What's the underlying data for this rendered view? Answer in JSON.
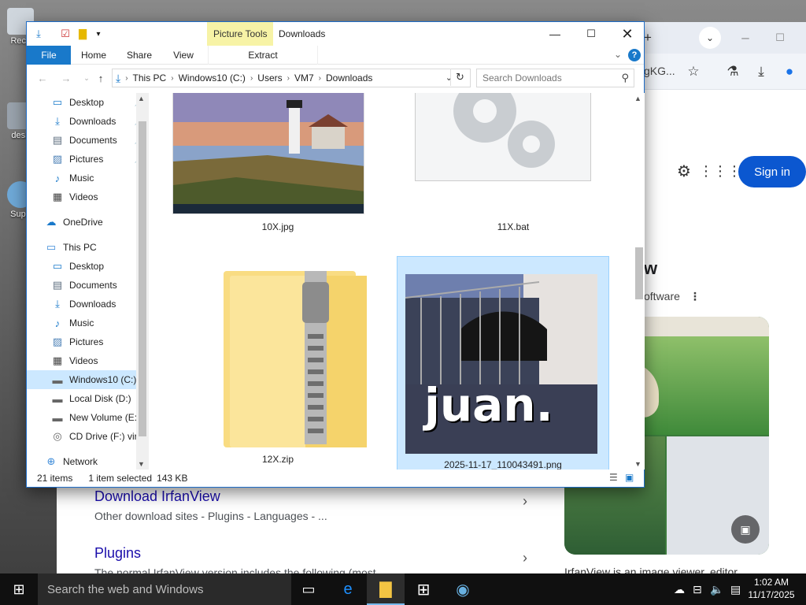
{
  "desktop": {
    "icons": [
      {
        "label": "Recy"
      },
      {
        "label": "desk"
      },
      {
        "label": "Supe"
      }
    ]
  },
  "browser": {
    "omnibox_fragment": "gKG...",
    "sign_in": "Sign in",
    "heading_fragment": "w",
    "subheading_fragment": "oftware",
    "more_menu": "⋮",
    "results": [
      {
        "title": "Download IrfanView",
        "desc": "Other download sites - Plugins - Languages - ..."
      },
      {
        "title": "Plugins",
        "desc": "The normal IrfanView version includes the following (most"
      }
    ],
    "panel_text": "IrfanView is an image viewer, editor,"
  },
  "explorer": {
    "context_tab": "Picture Tools",
    "title": "Downloads",
    "ribbon_tabs": [
      "File",
      "Home",
      "Share",
      "View"
    ],
    "ribbon_context": "Extract",
    "breadcrumbs": [
      "This PC",
      "Windows10 (C:)",
      "Users",
      "VM7",
      "Downloads"
    ],
    "search_placeholder": "Search Downloads",
    "nav": [
      {
        "label": "Desktop",
        "icon": "desktop-icon",
        "pinned": true
      },
      {
        "label": "Downloads",
        "icon": "download-icon",
        "pinned": true
      },
      {
        "label": "Documents",
        "icon": "document-icon",
        "pinned": true
      },
      {
        "label": "Pictures",
        "icon": "picture-icon",
        "pinned": true
      },
      {
        "label": "Music",
        "icon": "music-icon",
        "pinned": false
      },
      {
        "label": "Videos",
        "icon": "video-icon",
        "pinned": false
      },
      {
        "label": "OneDrive",
        "icon": "cloud-icon",
        "pinned": false
      },
      {
        "label": "This PC",
        "icon": "computer-icon",
        "pinned": false
      },
      {
        "label": "Desktop",
        "icon": "desktop-icon",
        "pinned": false
      },
      {
        "label": "Documents",
        "icon": "document-icon",
        "pinned": false
      },
      {
        "label": "Downloads",
        "icon": "download-icon",
        "pinned": false
      },
      {
        "label": "Music",
        "icon": "music-icon",
        "pinned": false
      },
      {
        "label": "Pictures",
        "icon": "picture-icon",
        "pinned": false
      },
      {
        "label": "Videos",
        "icon": "video-icon",
        "pinned": false
      },
      {
        "label": "Windows10 (C:)",
        "icon": "drive-icon",
        "pinned": false
      },
      {
        "label": "Local Disk (D:)",
        "icon": "drive-icon",
        "pinned": false
      },
      {
        "label": "New Volume (E:)",
        "icon": "drive-icon",
        "pinned": false
      },
      {
        "label": "CD Drive (F:) virt",
        "icon": "cd-drive-icon",
        "pinned": false
      },
      {
        "label": "Network",
        "icon": "network-icon",
        "pinned": false
      }
    ],
    "files": [
      {
        "name": "10X.jpg",
        "kind": "lighthouse-thumbnail"
      },
      {
        "name": "11X.bat",
        "kind": "batch-gears-icon"
      },
      {
        "name": "12X.zip",
        "kind": "zip-folder-icon"
      },
      {
        "name": "2025-11-17_110043491.png",
        "kind": "horse-balcony-thumbnail",
        "overlay_text": "juan.",
        "selected": true
      }
    ],
    "status": {
      "items": "21 items",
      "selected": "1 item selected",
      "size": "143 KB"
    }
  },
  "taskbar": {
    "search_placeholder": "Search the web and Windows",
    "time": "1:02 AM",
    "date": "11/17/2025"
  },
  "colors": {
    "accent": "#1979ca",
    "selection": "#cce8ff",
    "signin": "#0b57d0"
  }
}
